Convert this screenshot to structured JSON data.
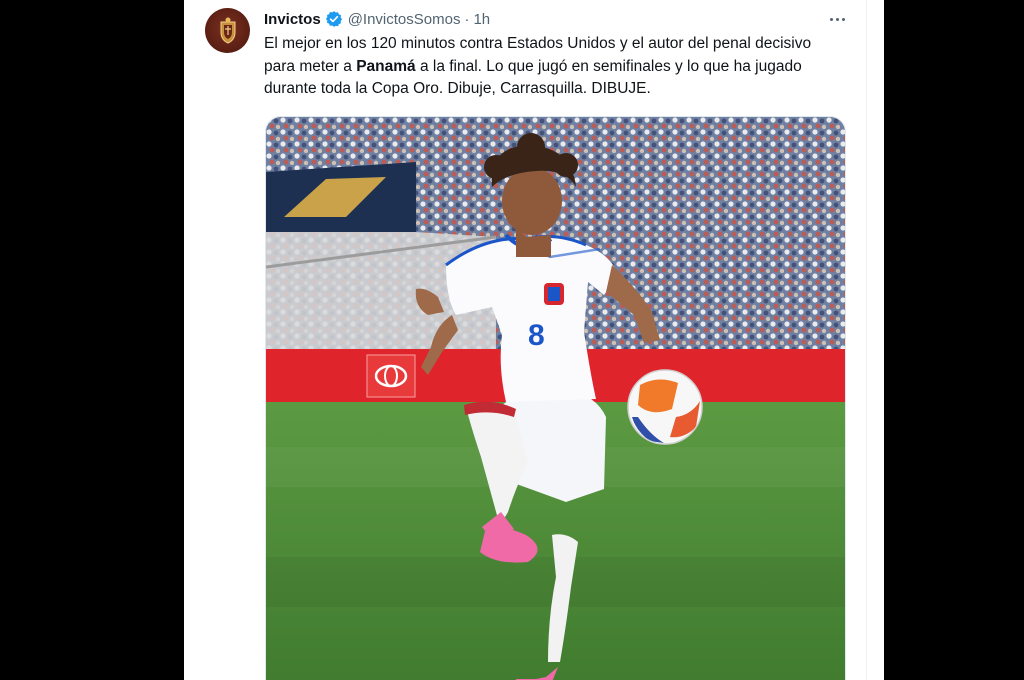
{
  "tweet": {
    "author_name": "Invictos",
    "handle": "@InvictosSomos",
    "separator": "·",
    "time": "1h",
    "text_part1": "El mejor en los 120 minutos contra Estados Unidos y el autor del penal decisivo para meter a ",
    "text_bold": "Panamá",
    "text_part2": " a la final. Lo que jugó en semifinales y lo que ha jugado durante toda la Copa Oro. Dibuje, Carrasquilla. DIBUJE.",
    "jersey_number": "8"
  },
  "icons": {
    "avatar": "club-crest-icon",
    "verified": "verified-badge-icon",
    "more": "more-options-icon"
  },
  "colors": {
    "avatar_bg": "#5a1e13",
    "verified_blue": "#1d9bf0",
    "ad_board_red": "#e0242b",
    "pitch_green": "#4f8f3a",
    "jersey_blue": "#1b56c9",
    "boot_pink": "#f06aa8"
  }
}
